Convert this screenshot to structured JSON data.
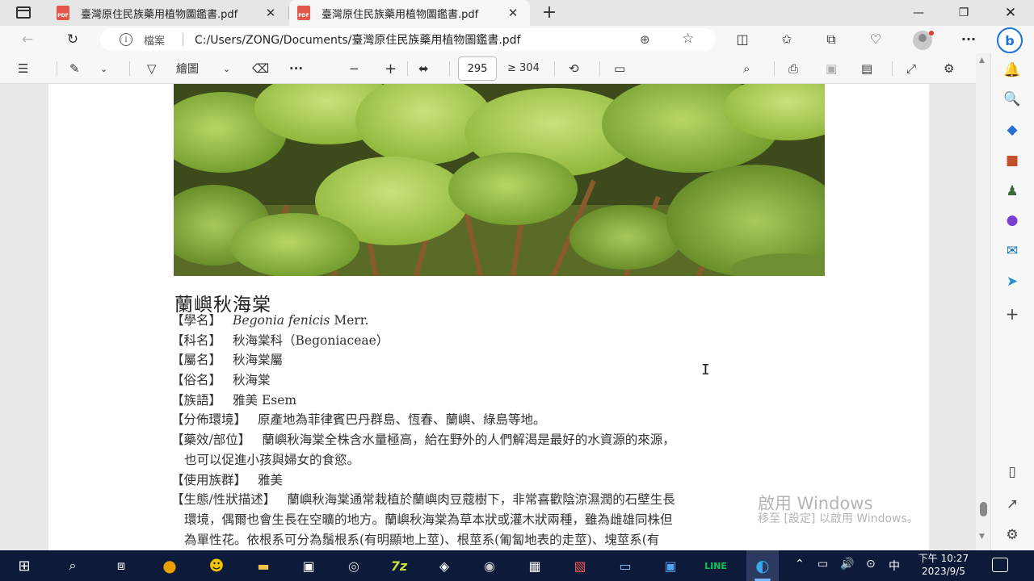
{
  "tabs": [
    {
      "icon": "pdf-icon",
      "title": "臺灣原住民族藥用植物圖鑑書.pdf",
      "active": false
    },
    {
      "icon": "pdf-icon",
      "title": "臺灣原住民族藥用植物圖鑑書.pdf",
      "active": true
    }
  ],
  "address": {
    "file_label": "檔案",
    "url": "C:/Users/ZONG/Documents/臺灣原住民族藥用植物圖鑑書.pdf"
  },
  "pdf_toolbar": {
    "draw_label": "繪圖",
    "current_page": "295",
    "total_pages": "304"
  },
  "document": {
    "title": "蘭嶼秋海棠",
    "lines": [
      {
        "k": "【學名】",
        "v1": "Begonia fenicis",
        "v2": " Merr.",
        "indent": false
      },
      {
        "k": "【科名】",
        "v1": "秋海棠科（Begoniaceae）",
        "v2": "",
        "indent": false
      },
      {
        "k": "【屬名】",
        "v1": "秋海棠屬",
        "v2": "",
        "indent": false
      },
      {
        "k": "【俗名】",
        "v1": "秋海棠",
        "v2": "",
        "indent": false
      },
      {
        "k": "【族語】",
        "v1": "雅美 Esem",
        "v2": "",
        "indent": false
      },
      {
        "k": "【分佈環境】",
        "v1": "原產地為菲律賓巴丹群島、恆春、蘭嶼、綠島等地。",
        "v2": "",
        "indent": false
      },
      {
        "k": "【藥效/部位】",
        "v1": "蘭嶼秋海棠全株含水量極高，給在野外的人們解渴是最好的水資源的來源，",
        "v2": "",
        "indent": false
      },
      {
        "k": "",
        "v1": "也可以促進小孩與婦女的食慾。",
        "v2": "",
        "indent": true
      },
      {
        "k": "【使用族群】",
        "v1": "雅美",
        "v2": "",
        "indent": false
      },
      {
        "k": "【生態/性狀描述】",
        "v1": "蘭嶼秋海棠通常栽植於蘭嶼肉豆蔻樹下，非常喜歡陰涼濕潤的石壁生長",
        "v2": "",
        "indent": false
      },
      {
        "k": "",
        "v1": "環境，偶爾也會生長在空曠的地方。蘭嶼秋海棠為草本狀或灌木狀兩種，雖為雌雄同株但",
        "v2": "",
        "indent": true
      },
      {
        "k": "",
        "v1": "為單性花。依根系可分為鬚根系(有明顯地上莖)、根莖系(匍匐地表的走莖)、塊莖系(有",
        "v2": "",
        "indent": true
      }
    ]
  },
  "watermark": {
    "line1": "啟用 Windows",
    "line2": "移至 [設定] 以啟用 Windows。"
  },
  "taskbar": {
    "clock_time": "下午 10:27",
    "clock_date": "2023/9/5",
    "ime": "中"
  },
  "colors": {
    "accent": "#1a73d8",
    "taskbar": "#0d1a3a",
    "pdf_red": "#e2584a"
  }
}
